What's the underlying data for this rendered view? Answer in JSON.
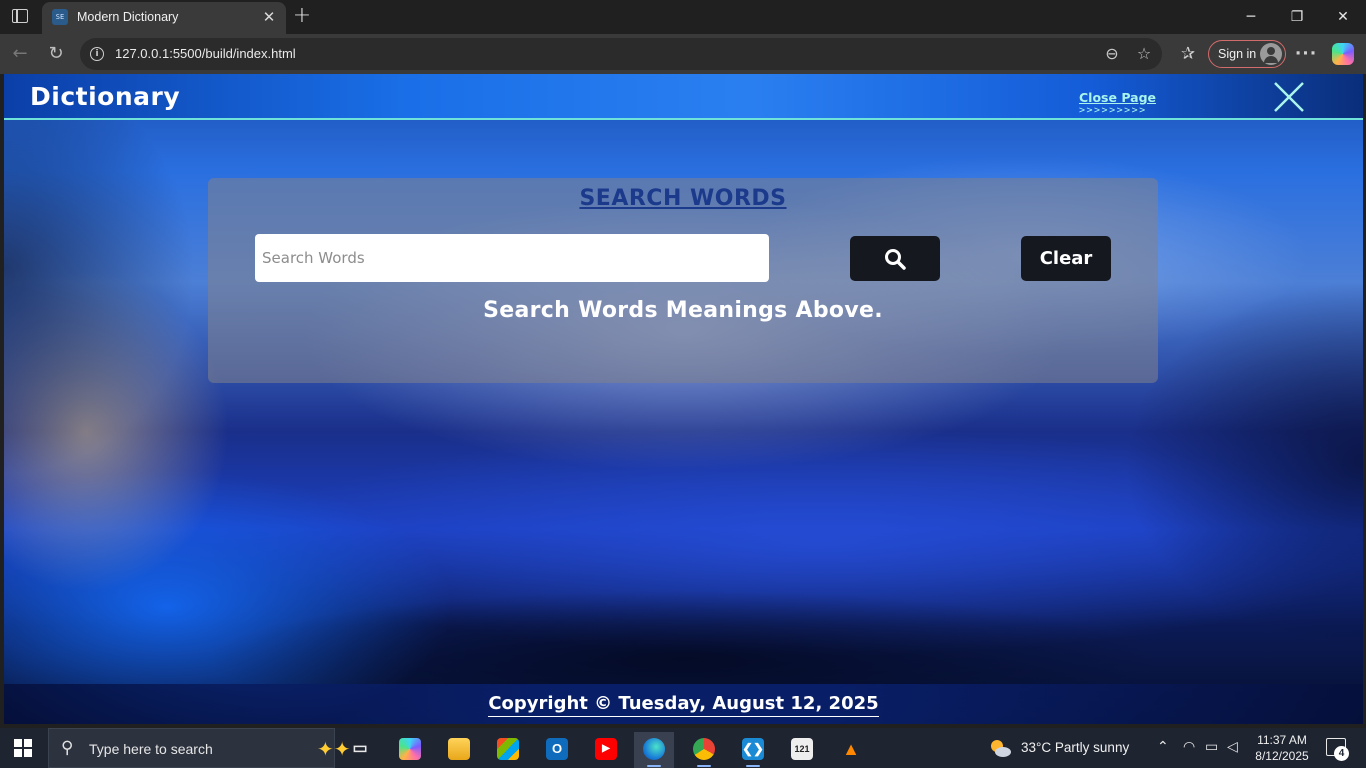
{
  "browser": {
    "tab_title": "Modern Dictionary",
    "tab_favicon_text": "SE",
    "url": "127.0.0.1:5500/build/index.html",
    "signin_label": "Sign in"
  },
  "page": {
    "site_title": "Dictionary",
    "close_page_label": "Close Page",
    "close_page_arrows": ">>>>>>>>>",
    "panel_title": "SEARCH WORDS",
    "search": {
      "placeholder": "Search Words",
      "value": ""
    },
    "clear_label": "Clear",
    "hint": "Search Words Meanings Above.",
    "copyright": "Copyright © Tuesday, August 12, 2025"
  },
  "taskbar": {
    "search_placeholder": "Type here to search",
    "apps": [
      {
        "name": "task-view-icon"
      },
      {
        "name": "copilot-icon"
      },
      {
        "name": "file-explorer-icon"
      },
      {
        "name": "microsoft-store-icon"
      },
      {
        "name": "outlook-icon",
        "glyph": "O"
      },
      {
        "name": "youtube-icon"
      },
      {
        "name": "edge-icon"
      },
      {
        "name": "chrome-icon"
      },
      {
        "name": "vscode-icon"
      },
      {
        "name": "calendar-app-icon",
        "glyph": "121"
      },
      {
        "name": "vlc-icon"
      }
    ],
    "weather": "33°C  Partly sunny",
    "time": "11:37 AM",
    "date": "8/12/2025",
    "notification_count": "4"
  },
  "colors": {
    "header_accent": "#6fe3d9",
    "panel_title": "#1c3a8c",
    "button_bg": "#15181f"
  }
}
